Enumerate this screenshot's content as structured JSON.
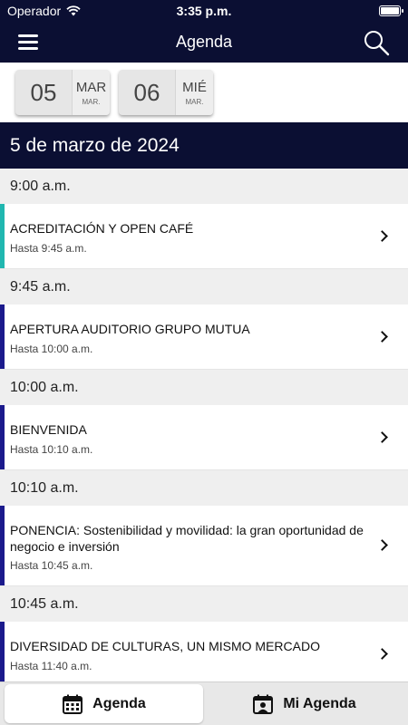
{
  "status": {
    "carrier": "Operador",
    "time": "3:35 p.m.",
    "battery_level": 1.0
  },
  "nav": {
    "title": "Agenda",
    "menu_icon": "hamburger-icon",
    "search_icon": "search-icon"
  },
  "date_chips": [
    {
      "day": "05",
      "weekday": "MAR",
      "weekday_small": "MAR."
    },
    {
      "day": "06",
      "weekday": "MIÉ",
      "weekday_small": "MAR."
    }
  ],
  "date_header": "5 de marzo de 2024",
  "agenda": [
    {
      "time": "9:00 a.m.",
      "title": "ACREDITACIÓN Y OPEN CAFÉ",
      "until": "Hasta 9:45 a.m.",
      "color": "#20b7b0"
    },
    {
      "time": "9:45 a.m.",
      "title": "APERTURA AUDITORIO GRUPO MUTUA",
      "until": "Hasta 10:00 a.m.",
      "color": "#1b1a8c"
    },
    {
      "time": "10:00 a.m.",
      "title": "BIENVENIDA",
      "until": "Hasta 10:10 a.m.",
      "color": "#1b1a8c"
    },
    {
      "time": "10:10 a.m.",
      "title": "PONENCIA: Sostenibilidad y movilidad: la gran oportunidad de negocio e inversión",
      "until": "Hasta 10:45 a.m.",
      "color": "#1b1a8c"
    },
    {
      "time": "10:45 a.m.",
      "title": "DIVERSIDAD DE CULTURAS, UN MISMO MERCADO",
      "until": "Hasta 11:40 a.m.",
      "color": "#1b1a8c"
    }
  ],
  "tabs": [
    {
      "label": "Agenda",
      "icon": "calendar-icon",
      "active": true
    },
    {
      "label": "Mi Agenda",
      "icon": "calendar-person-icon",
      "active": false
    }
  ],
  "colors": {
    "navy": "#0b0f33",
    "teal": "#20b7b0",
    "indigo": "#1b1a8c"
  }
}
